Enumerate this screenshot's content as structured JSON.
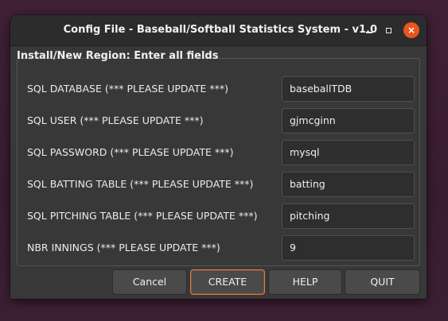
{
  "window": {
    "title": "Config File - Baseball/Softball Statistics System - v1.0",
    "close_label": "×"
  },
  "group": {
    "label": "Install/New Region: Enter all fields"
  },
  "fields": [
    {
      "label": "SQL DATABASE (*** PLEASE UPDATE ***)",
      "value": "baseballTDB"
    },
    {
      "label": "SQL USER (*** PLEASE UPDATE ***)",
      "value": "gjmcginn"
    },
    {
      "label": "SQL PASSWORD (*** PLEASE UPDATE ***)",
      "value": "mysql"
    },
    {
      "label": "SQL BATTING TABLE (*** PLEASE UPDATE ***)",
      "value": "batting"
    },
    {
      "label": "SQL PITCHING TABLE (*** PLEASE UPDATE ***)",
      "value": "pitching"
    },
    {
      "label": "NBR INNINGS (*** PLEASE UPDATE ***)",
      "value": "9"
    }
  ],
  "buttons": {
    "cancel": "Cancel",
    "create": "CREATE",
    "help": "HELP",
    "quit": "QUIT"
  },
  "colors": {
    "accent": "#e95420",
    "window_bg": "#383838",
    "titlebar_bg": "#2c2c2c",
    "desktop_bg": "#3c1f33"
  }
}
